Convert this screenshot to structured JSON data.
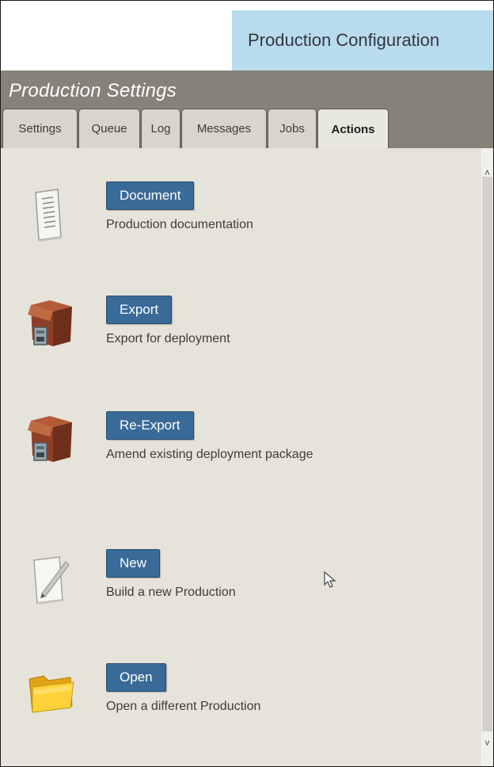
{
  "header": {
    "title": "Production Configuration"
  },
  "panel": {
    "title": "Production Settings"
  },
  "tabs": [
    {
      "label": "Settings"
    },
    {
      "label": "Queue"
    },
    {
      "label": "Log"
    },
    {
      "label": "Messages"
    },
    {
      "label": "Jobs"
    },
    {
      "label": "Actions"
    }
  ],
  "actions": [
    {
      "button": "Document",
      "description": "Production documentation",
      "icon": "document-icon"
    },
    {
      "button": "Export",
      "description": "Export for deployment",
      "icon": "export-package-icon"
    },
    {
      "button": "Re-Export",
      "description": "Amend existing deployment package",
      "icon": "reexport-package-icon"
    },
    {
      "button": "New",
      "description": "Build a new Production",
      "icon": "new-document-icon"
    },
    {
      "button": "Open",
      "description": "Open a different Production",
      "icon": "folder-icon"
    }
  ],
  "colors": {
    "title_tab": "#b8dcee",
    "header_bar": "#858278",
    "content_bg": "#e6e4da",
    "button_bg": "#3a6a97"
  }
}
